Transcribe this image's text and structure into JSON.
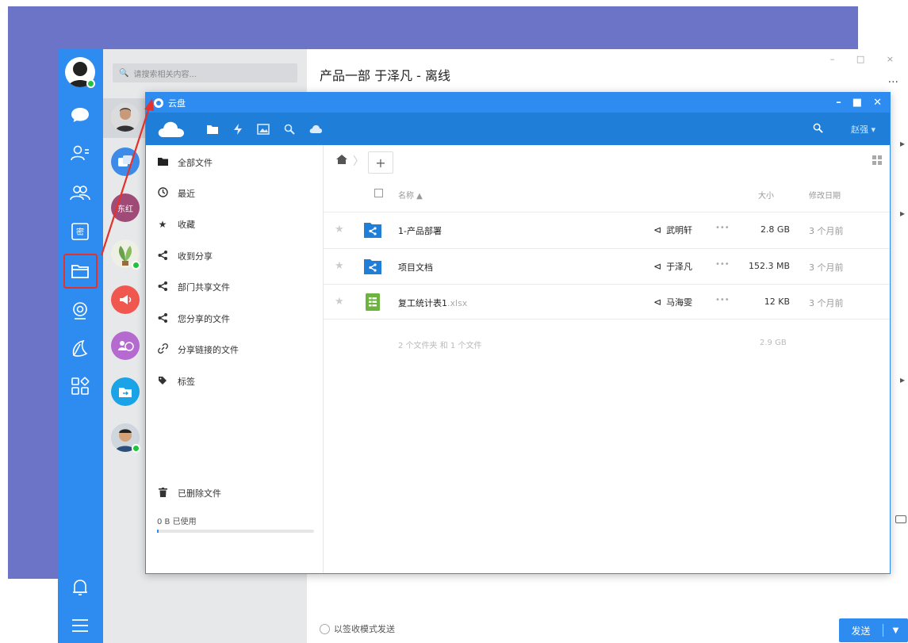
{
  "chat": {
    "title": "产品一部 于泽凡 - 离线",
    "search_placeholder": "请搜索相关内容...",
    "sign_mode_label": "以签收模式发送",
    "send_label": "发送",
    "more": "...",
    "window_controls": "– □ ×",
    "contact_badge": "东红"
  },
  "cloud": {
    "title": "云盘",
    "window_controls": {
      "minimize": "–",
      "maximize": "■",
      "close": "✕"
    },
    "user": "赵强 ▾",
    "sidebar": {
      "items": [
        {
          "label": "全部文件",
          "icon": "folder-icon"
        },
        {
          "label": "最近",
          "icon": "clock-icon"
        },
        {
          "label": "收藏",
          "icon": "star-icon"
        },
        {
          "label": "收到分享",
          "icon": "share-icon"
        },
        {
          "label": "部门共享文件",
          "icon": "share-icon"
        },
        {
          "label": "您分享的文件",
          "icon": "share-icon"
        },
        {
          "label": "分享链接的文件",
          "icon": "link-icon"
        },
        {
          "label": "标签",
          "icon": "tag-icon"
        }
      ],
      "trash_label": "已删除文件",
      "usage_label": "0 B 已使用",
      "usage_fraction": 0.01
    },
    "list": {
      "header_name": "名称 ▲",
      "header_size": "大小",
      "header_date": "修改日期",
      "files": [
        {
          "name": "1-产品部署",
          "ext": "",
          "type": "shared-folder",
          "owner": "武明轩",
          "size": "2.8 GB",
          "date": "3 个月前"
        },
        {
          "name": "项目文档",
          "ext": "",
          "type": "shared-folder",
          "owner": "于泽凡",
          "size": "152.3 MB",
          "date": "3 个月前"
        },
        {
          "name": "复工统计表1",
          "ext": ".xlsx",
          "type": "spreadsheet",
          "owner": "马海雯",
          "size": "12 KB",
          "date": "3 个月前"
        }
      ],
      "summary_text": "2 个文件夹 和 1 个文件",
      "summary_size": "2.9 GB",
      "row_dots": "•••"
    }
  },
  "colors": {
    "accent": "#2e8cf0",
    "toolbar": "#1f7ed8",
    "backdrop": "#6b74c6",
    "highlight": "#e5312b"
  }
}
